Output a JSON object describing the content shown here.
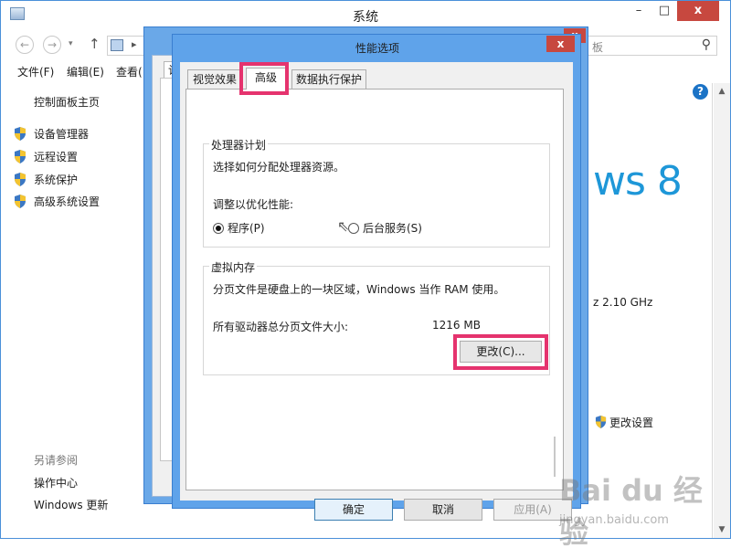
{
  "system_window": {
    "title": "系统",
    "controls": {
      "minimize": "–",
      "maximize": "□",
      "close": "x"
    },
    "address": {
      "back": "←",
      "forward": "→",
      "history": "▾",
      "up": "↑",
      "chevron": "▸"
    },
    "search": {
      "visible_text": "板",
      "icon": "search-icon"
    },
    "menu": {
      "file": "文件(F)",
      "edit": "编辑(E)",
      "view": "查看("
    },
    "left_pane": {
      "home": "控制面板主页",
      "tasks": [
        {
          "label": "设备管理器",
          "icon": "uac-shield-icon"
        },
        {
          "label": "远程设置",
          "icon": "uac-shield-icon"
        },
        {
          "label": "系统保护",
          "icon": "uac-shield-icon"
        },
        {
          "label": "高级系统设置",
          "icon": "uac-shield-icon"
        }
      ],
      "see_also": "另请参阅",
      "action_center": "操作中心",
      "windows_update": "Windows 更新"
    },
    "right": {
      "help": "?",
      "logo_text": "ws 8",
      "cpu_speed": "z   2.10 GHz",
      "change_settings": "更改设置"
    }
  },
  "system_properties": {
    "close": "x",
    "tab_label": "计"
  },
  "performance_options": {
    "title": "性能选项",
    "close": "x",
    "tabs": [
      "视觉效果",
      "高级",
      "数据执行保护"
    ],
    "active_tab": "高级",
    "processor": {
      "legend": "处理器计划",
      "description": "选择如何分配处理器资源。",
      "adjust_label": "调整以优化性能:",
      "options": [
        {
          "label": "程序(P)",
          "checked": true
        },
        {
          "label": "后台服务(S)",
          "checked": false
        }
      ]
    },
    "virtual_memory": {
      "legend": "虚拟内存",
      "description": "分页文件是硬盘上的一块区域，Windows 当作 RAM 使用。",
      "total_label": "所有驱动器总分页文件大小:",
      "total_value": "1216 MB",
      "change_button": "更改(C)..."
    },
    "buttons": {
      "ok": "确定",
      "cancel": "取消",
      "apply": "应用(A)"
    },
    "highlight_color": "#e5336e"
  },
  "watermark": {
    "brand": "Bai du 经验",
    "sub": "jingyan.baidu.com"
  },
  "colors": {
    "accent_blue": "#5fa3ea",
    "close_red": "#c7483f",
    "win8_blue": "#1e97d8"
  }
}
